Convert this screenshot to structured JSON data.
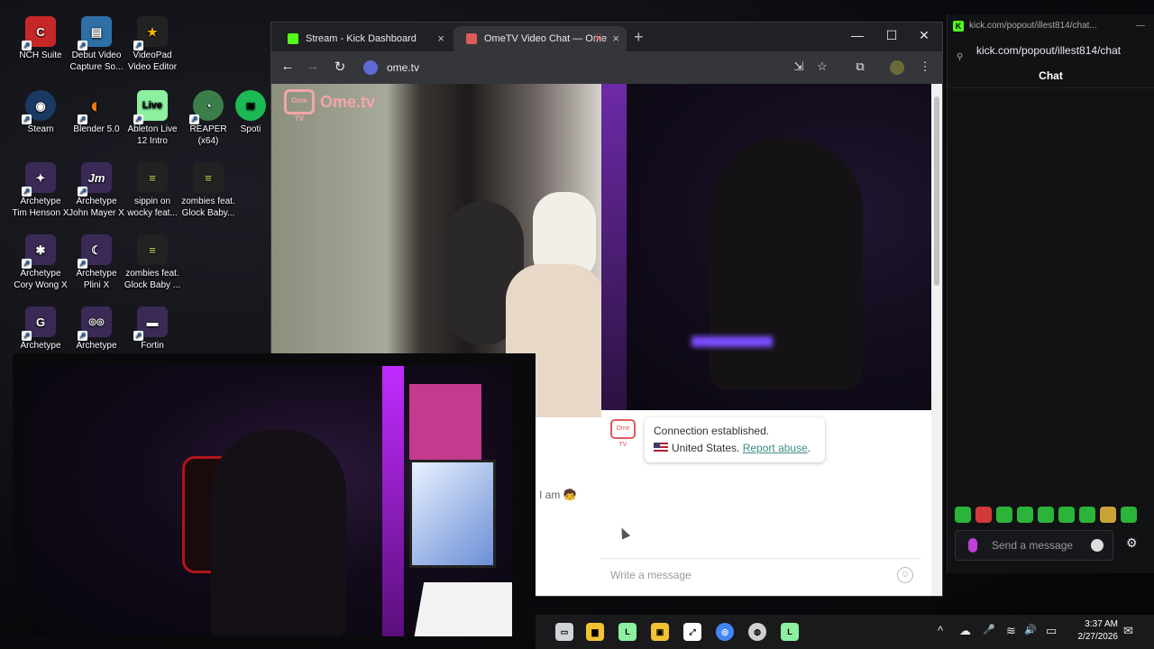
{
  "desktop": {
    "icons": [
      {
        "line1": "NCH Suite",
        "line2": "",
        "color": "#c62828",
        "glyph": "C"
      },
      {
        "line1": "Debut Video",
        "line2": "Capture So...",
        "color": "#2e6fa7",
        "glyph": "▤"
      },
      {
        "line1": "VideoPad",
        "line2": "Video Editor",
        "color": "#f2b705",
        "glyph": "★"
      },
      {
        "line1": "Steam",
        "line2": "",
        "color": "#1b3a63",
        "glyph": "◉"
      },
      {
        "line1": "Blender 5.0",
        "line2": "",
        "color": "#e87d0d",
        "glyph": "◐"
      },
      {
        "line1": "Ableton Live",
        "line2": "12 Intro",
        "color": "#8cf0a0",
        "glyph": "Live"
      },
      {
        "line1": "REAPER (x64)",
        "line2": "",
        "color": "#3b7e4a",
        "glyph": "◔"
      },
      {
        "line1": "Spoti",
        "line2": "",
        "color": "#1db954",
        "glyph": "≋"
      },
      {
        "line1": "Archetype",
        "line2": "Tim Henson X",
        "color": "#3a2a55",
        "glyph": "✦"
      },
      {
        "line1": "Archetype",
        "line2": "John Mayer X",
        "color": "#3a2a55",
        "glyph": "Jm"
      },
      {
        "line1": "sippin on",
        "line2": "wocky feat...",
        "color": "#222",
        "glyph": "≡"
      },
      {
        "line1": "zombies feat.",
        "line2": "Glock Baby...",
        "color": "#222",
        "glyph": "≡"
      },
      {
        "line1": "Archetype",
        "line2": "Cory Wong X",
        "color": "#3a2a55",
        "glyph": "✱"
      },
      {
        "line1": "Archetype",
        "line2": "Plini X",
        "color": "#3a2a55",
        "glyph": "☾"
      },
      {
        "line1": "zombies feat.",
        "line2": "Glock Baby ...",
        "color": "#222",
        "glyph": "≡"
      },
      {
        "line1": "Archetype",
        "line2": "",
        "color": "#3a2a55",
        "glyph": "G"
      },
      {
        "line1": "Archetype",
        "line2": "",
        "color": "#3a2a55",
        "glyph": "◎◎"
      },
      {
        "line1": "Fortin",
        "line2": "",
        "color": "#3a2a55",
        "glyph": "▬"
      }
    ]
  },
  "browser": {
    "tabs": [
      {
        "title": "Stream - Kick Dashboard",
        "favicon_color": "#53fc18",
        "close": "×"
      },
      {
        "title": "OmeTV Video Chat — Ome",
        "favicon_color": "#e05a5a",
        "close": "×",
        "recording": "⦿"
      }
    ],
    "new_tab": "+",
    "window_controls": {
      "minimize": "—",
      "maximize": "☐",
      "close": "✕"
    },
    "nav": {
      "back": "←",
      "forward": "→",
      "reload": "↻"
    },
    "url": "ome.tv",
    "toolbar_icons": {
      "install": "⇲",
      "bookmark": "☆",
      "sidepanel": "⧉",
      "menu": "⋮"
    }
  },
  "ometv": {
    "logo_text": "Ome.tv",
    "logo_badge": "Ome TV",
    "system_message": {
      "line1": "Connection established.",
      "country": "United States.",
      "report_link": "Report abuse",
      "report_suffix": "."
    },
    "input_placeholder": "Write a message",
    "emoji_button": "☺"
  },
  "overlay": {
    "partial_text": "I am 🧒"
  },
  "kick_popout": {
    "window_title": "kick.com/popout/illest814/chat...",
    "url": "kick.com/popout/illest814/chat",
    "chat_title": "Chat",
    "send_placeholder": "Send a message",
    "minimize": "—",
    "settings_icon": "⚙",
    "emote_count": 9
  },
  "taskbar": {
    "apps": [
      {
        "name": "task-view",
        "color": "#cfd3da",
        "glyph": "▭"
      },
      {
        "name": "file-explorer",
        "color": "#f2c233",
        "glyph": "▆"
      },
      {
        "name": "ableton-live",
        "color": "#8cf0a0",
        "glyph": "L"
      },
      {
        "name": "sticky",
        "color": "#f2c233",
        "glyph": "▣"
      },
      {
        "name": "capcut",
        "color": "#ffffff",
        "glyph": "⤢"
      },
      {
        "name": "chrome",
        "color": "#4285f4",
        "glyph": "◎"
      },
      {
        "name": "obs",
        "color": "#d0d0d0",
        "glyph": "◍"
      },
      {
        "name": "ableton-live-2",
        "color": "#8cf0a0",
        "glyph": "L"
      }
    ],
    "tray": {
      "overflow": "^",
      "onedrive": "☁",
      "mic": "🎤",
      "wifi": "≋",
      "volume": "🔊",
      "battery": "▭"
    },
    "time": "3:37 AM",
    "date": "2/27/2026",
    "notifications": "✉"
  }
}
